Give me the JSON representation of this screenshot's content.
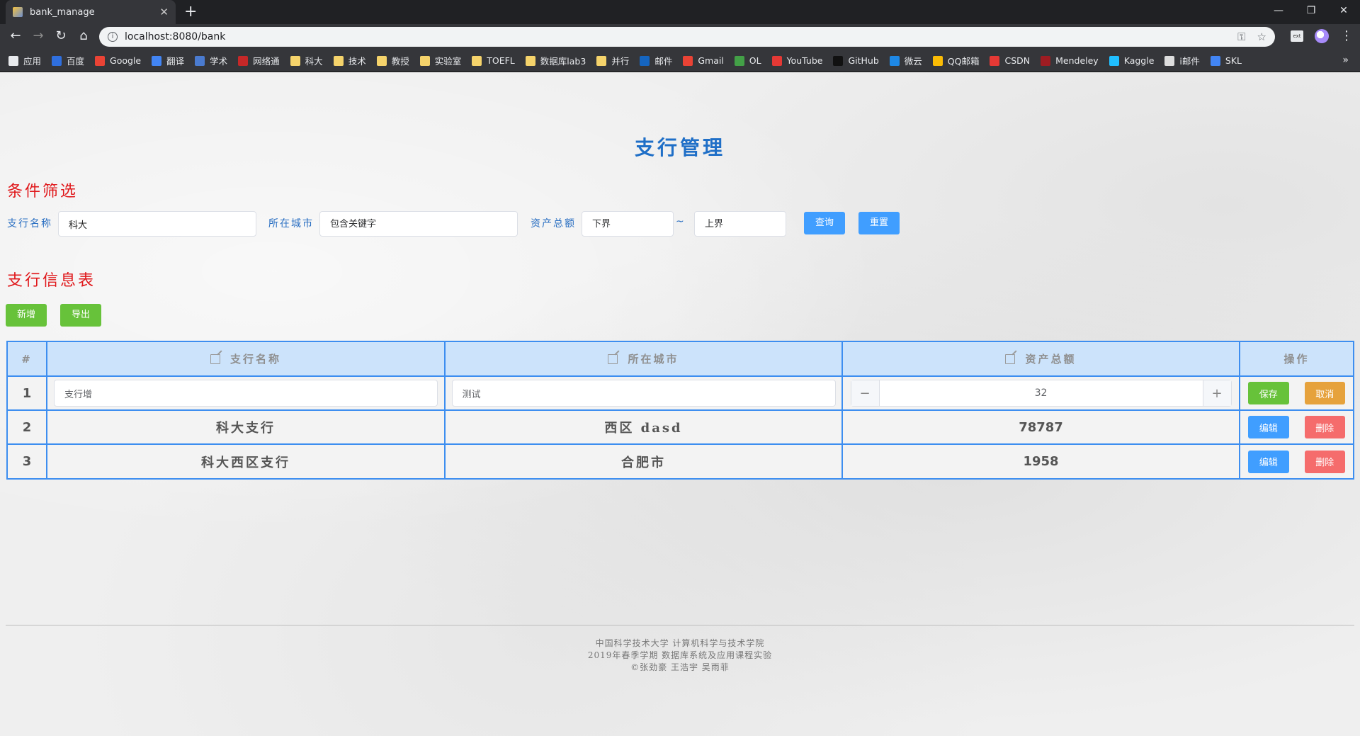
{
  "browser": {
    "tab_title": "bank_manage",
    "url": "localhost:8080/bank",
    "bookmarks": [
      {
        "label": "应用",
        "color": "#e8eaed"
      },
      {
        "label": "百度",
        "color": "#2f6fde"
      },
      {
        "label": "Google",
        "color": "#ea4335"
      },
      {
        "label": "翻译",
        "color": "#4285f4"
      },
      {
        "label": "学术",
        "color": "#4a7bd0"
      },
      {
        "label": "网络通",
        "color": "#c62828"
      },
      {
        "label": "科大",
        "color": "#f5d36b"
      },
      {
        "label": "技术",
        "color": "#f5d36b"
      },
      {
        "label": "教授",
        "color": "#f5d36b"
      },
      {
        "label": "实验室",
        "color": "#f5d36b"
      },
      {
        "label": "TOEFL",
        "color": "#f5d36b"
      },
      {
        "label": "数据库lab3",
        "color": "#f5d36b"
      },
      {
        "label": "并行",
        "color": "#f5d36b"
      },
      {
        "label": "邮件",
        "color": "#1565c0"
      },
      {
        "label": "Gmail",
        "color": "#ea4335"
      },
      {
        "label": "OL",
        "color": "#43a047"
      },
      {
        "label": "YouTube",
        "color": "#e53935"
      },
      {
        "label": "GitHub",
        "color": "#111111"
      },
      {
        "label": "微云",
        "color": "#1e88e5"
      },
      {
        "label": "QQ邮箱",
        "color": "#fbbc05"
      },
      {
        "label": "CSDN",
        "color": "#e53935"
      },
      {
        "label": "Mendeley",
        "color": "#9e1c22"
      },
      {
        "label": "Kaggle",
        "color": "#20beff"
      },
      {
        "label": "i邮件",
        "color": "#dddddd"
      },
      {
        "label": "SKL",
        "color": "#4285f4"
      }
    ]
  },
  "page": {
    "title": "支行管理",
    "filter_section_title": "条件筛选",
    "table_section_title": "支行信息表"
  },
  "filters": {
    "name_label": "支行名称",
    "name_value": "科大",
    "city_label": "所在城市",
    "city_placeholder": "包含关键字",
    "asset_label": "资产总额",
    "asset_lower_placeholder": "下界",
    "range_separator": "~",
    "asset_upper_placeholder": "上界",
    "query_button": "查询",
    "reset_button": "重置"
  },
  "actions": {
    "add_button": "新增",
    "export_button": "导出"
  },
  "table": {
    "headers": {
      "index": "#",
      "name": "支行名称",
      "city": "所在城市",
      "assets": "资产总额",
      "ops": "操作"
    },
    "editing_row": {
      "index": "1",
      "name_value": "支行增",
      "city_value": "测试",
      "assets_value": "32",
      "minus": "−",
      "plus": "+",
      "save_button": "保存",
      "cancel_button": "取消"
    },
    "rows": [
      {
        "index": "2",
        "name": "科大支行",
        "city": "西区 dasd",
        "assets": "78787",
        "edit_button": "编辑",
        "delete_button": "删除"
      },
      {
        "index": "3",
        "name": "科大西区支行",
        "city": "合肥市",
        "assets": "1958",
        "edit_button": "编辑",
        "delete_button": "删除"
      }
    ]
  },
  "footer": {
    "line1": "中国科学技术大学 计算机科学与技术学院",
    "line2": "2019年春季学期 数据库系统及应用课程实验",
    "line3": "©张劲豪 王浩宇 吴雨菲"
  }
}
